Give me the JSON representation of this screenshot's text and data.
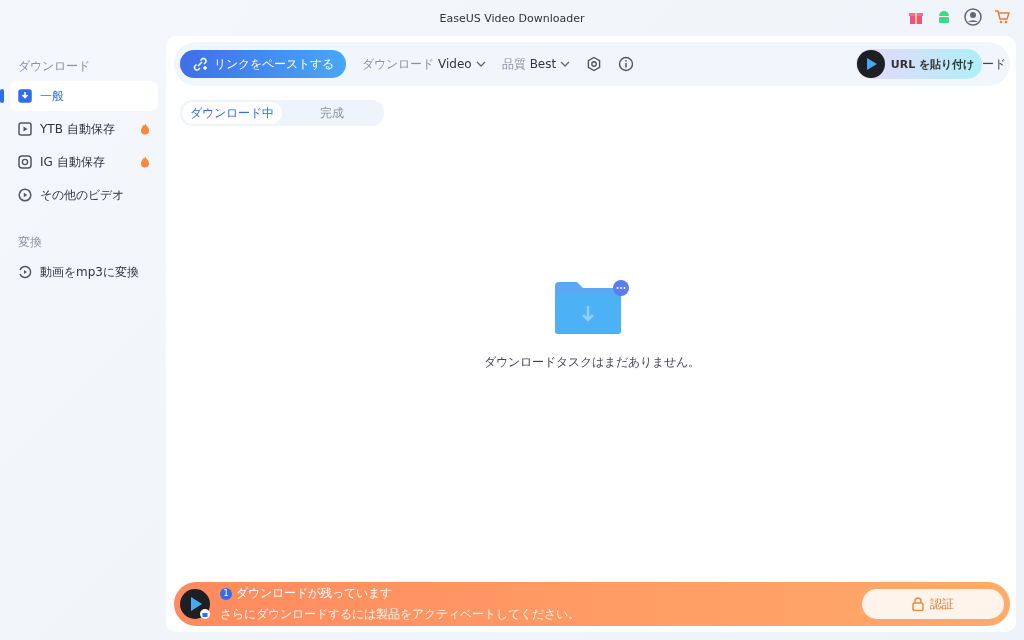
{
  "window": {
    "title": "EaseUS Video Downloader"
  },
  "sidebar": {
    "sections": [
      {
        "heading": "ダウンロード",
        "items": [
          {
            "label": "一般",
            "selected": true,
            "hot": false
          },
          {
            "label": "YTB 自動保存",
            "selected": false,
            "hot": true
          },
          {
            "label": "IG 自動保存",
            "selected": false,
            "hot": true
          },
          {
            "label": "その他のビデオ",
            "selected": false,
            "hot": false
          }
        ]
      },
      {
        "heading": "変換",
        "items": [
          {
            "label": "動画をmp3に変換",
            "selected": false,
            "hot": false
          }
        ]
      }
    ]
  },
  "toolbar": {
    "paste_button": "リンクをペーストする",
    "download_label": "ダウンロード",
    "download_value": "Video",
    "quality_label": "品質",
    "quality_value": "Best",
    "url_button": "URL を貼り付け",
    "hidden_text": "ード"
  },
  "tabs": [
    {
      "label": "ダウンロード中",
      "selected": true
    },
    {
      "label": "完成",
      "selected": false
    }
  ],
  "empty_message": "ダウンロードタスクはまだありません。",
  "banner": {
    "count": "1",
    "title": "ダウンロードが残っています",
    "subtitle": "さらにダウンロードするには製品をアクティベートしてください。",
    "button": "認証"
  }
}
